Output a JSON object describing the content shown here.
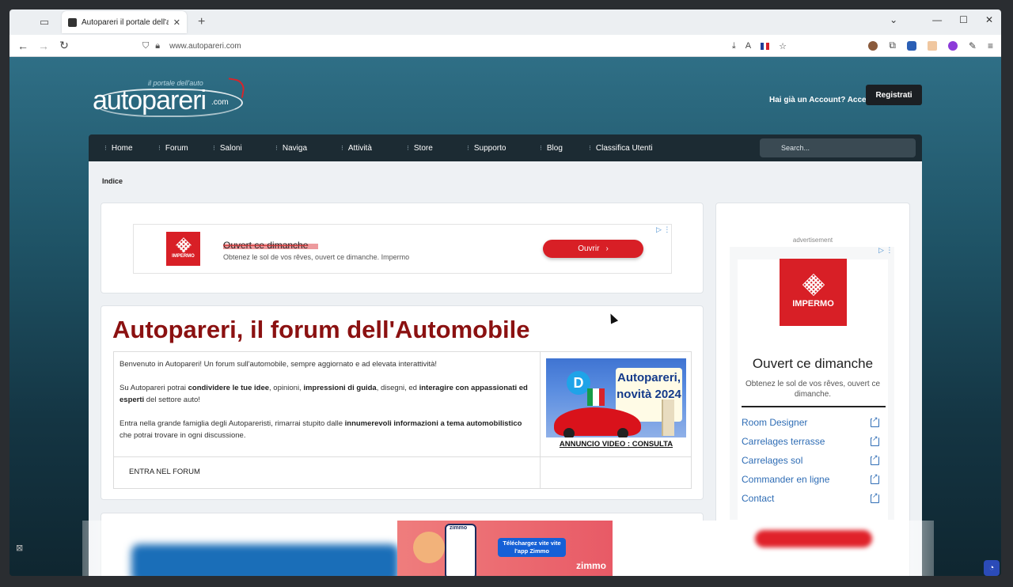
{
  "browser": {
    "tab_title": "Autopareri il portale dell'autom",
    "url": "www.autopareri.com"
  },
  "header": {
    "logo_tagline": "il portale dell'auto",
    "logo_text": "autopareri",
    "logo_suffix": ".com",
    "account_link": "Hai già un Account? Accedi",
    "register": "Registrati"
  },
  "nav": {
    "items": [
      "Home",
      "Forum",
      "Saloni",
      "Naviga",
      "Attività",
      "Store",
      "Supporto",
      "Blog",
      "Classifica Utenti"
    ],
    "search_placeholder": "Search..."
  },
  "breadcrumb": "Indice",
  "ad_top": {
    "brand": "IMPERMO",
    "title": "Ouvert ce dimanche",
    "desc": "Obtenez le sol de vos rêves, ouvert ce dimanche. Impermo",
    "button": "Ouvrir"
  },
  "main": {
    "title": "Autopareri, il forum dell'Automobile",
    "para1": "Benvenuto in Autopareri! Un forum sull'automobile, sempre aggiornato e ad elevata interattività!",
    "para2_a": "Su Autopareri potrai ",
    "para2_b": "condividere le tue idee",
    "para2_c": ", opinioni, ",
    "para2_d": "impressioni di guida",
    "para2_e": ", disegni, ed ",
    "para2_f": "interagire con appassionati ed esperti",
    "para2_g": " del settore auto!",
    "para3_a": "Entra nella grande famiglia degli Autopareristi, rimarrai stupito dalle ",
    "para3_b": "innumerevoli informazioni a tema automobilistico",
    "para3_c": " che potrai trovare in ogni discussione.",
    "enter_forum": "ENTRA NEL FORUM",
    "promo_d": "D",
    "promo_label": "Autopareri, novità 2024",
    "promo_caption": "ANNUNCIO VIDEO : CONSULTA"
  },
  "sidebar_ad": {
    "label": "advertisement",
    "brand": "IMPERMO",
    "headline": "Ouvert ce dimanche",
    "desc": "Obtenez le sol de vos rêves, ouvert ce dimanche.",
    "links": [
      "Room Designer",
      "Carrelages terrasse",
      "Carrelages sol",
      "Commander en ligne",
      "Contact"
    ]
  },
  "sticky_ad": {
    "top_brand": "zimmo",
    "cta": "Téléchargez vite vite l'app Zimmo",
    "brand": "zimmo"
  },
  "colors": {
    "brand_red": "#8b1111",
    "impermo_red": "#d81f26",
    "nav_bg": "#1c2b33",
    "link_blue": "#2f6db5"
  },
  "icons": [
    "tab-list-icon",
    "back-icon",
    "forward-icon",
    "reload-icon",
    "shield-icon",
    "lock-icon",
    "download-icon",
    "translate-icon",
    "star-icon",
    "extensions-icon",
    "menu-icon",
    "external-link-icon",
    "close-icon",
    "cookie-icon"
  ]
}
